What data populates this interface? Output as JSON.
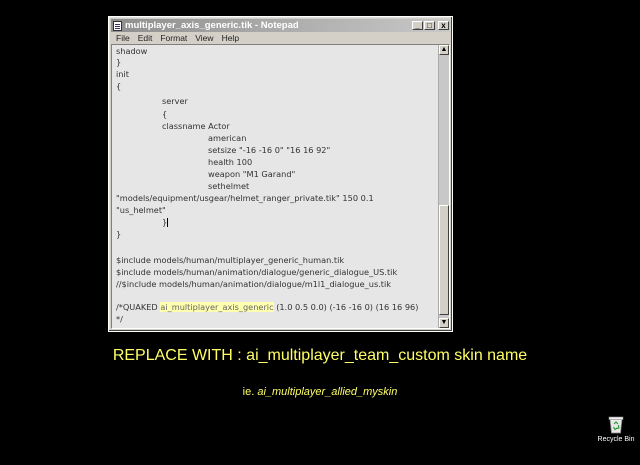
{
  "window": {
    "title": "multiplayer_axis_generic.tik - Notepad",
    "buttons": {
      "minimize": "_",
      "maximize": "□",
      "close": "x"
    }
  },
  "menu": [
    "File",
    "Edit",
    "Format",
    "View",
    "Help"
  ],
  "editor": {
    "lines": {
      "l0": "shadow",
      "l1": "}",
      "l2": "init",
      "l3": "{",
      "l4": "server",
      "l5": "{",
      "l6": "classname Actor",
      "l7": "american",
      "l8": "setsize \"-16 -16 0\" \"16 16 92\"",
      "l9": "health 100",
      "l10": "weapon \"M1 Garand\"",
      "l11": "sethelmet",
      "l12": "\"models/equipment/usgear/helmet_ranger_private.tik\" 150 0.1",
      "l13": "\"us_helmet\"",
      "l14": "}",
      "l15": "}",
      "l16": "$include models/human/multiplayer_generic_human.tik",
      "l17": "$include models/human/animation/dialogue/generic_dialogue_US.tik",
      "l18": "//$include models/human/animation/dialogue/m1l1_dialogue_us.tik",
      "l19a": "/*QUAKED ",
      "l19b": "ai_multiplayer_axis_generic",
      "l19c": " (1.0 0.5 0.0) (-16 -16 0) (16 16 96)",
      "l20": "*/"
    },
    "scroll": {
      "up": "▲",
      "down": "▼"
    }
  },
  "instruction": {
    "replace": "REPLACE WITH : ai_multiplayer_team_custom skin name",
    "example_prefix": "ie. ",
    "example": "ai_multiplayer_allied_myskin"
  },
  "desktop": {
    "recycle_bin_label": "Recycle Bin"
  }
}
